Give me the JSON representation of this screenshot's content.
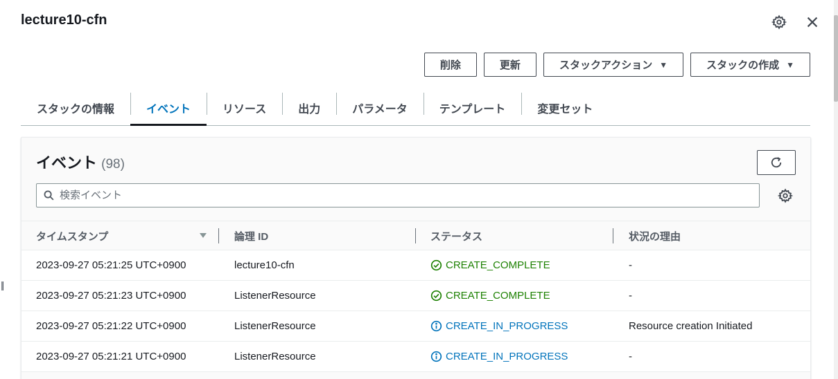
{
  "window": {
    "title": "lecture10-cfn"
  },
  "actions": {
    "delete_label": "削除",
    "update_label": "更新",
    "stack_actions_label": "スタックアクション",
    "create_stack_label": "スタックの作成"
  },
  "tabs": [
    {
      "label": "スタックの情報"
    },
    {
      "label": "イベント"
    },
    {
      "label": "リソース"
    },
    {
      "label": "出力"
    },
    {
      "label": "パラメータ"
    },
    {
      "label": "テンプレート"
    },
    {
      "label": "変更セット"
    }
  ],
  "events": {
    "title": "イベント",
    "count": "(98)",
    "search_placeholder": "検索イベント",
    "columns": {
      "timestamp": "タイムスタンプ",
      "logical_id": "論理 ID",
      "status": "ステータス",
      "reason": "状況の理由"
    },
    "rows": [
      {
        "timestamp": "2023-09-27 05:21:25 UTC+0900",
        "logical_id": "lecture10-cfn",
        "status": "CREATE_COMPLETE",
        "reason": "-"
      },
      {
        "timestamp": "2023-09-27 05:21:23 UTC+0900",
        "logical_id": "ListenerResource",
        "status": "CREATE_COMPLETE",
        "reason": "-"
      },
      {
        "timestamp": "2023-09-27 05:21:22 UTC+0900",
        "logical_id": "ListenerResource",
        "status": "CREATE_IN_PROGRESS",
        "reason": "Resource creation Initiated"
      },
      {
        "timestamp": "2023-09-27 05:21:21 UTC+0900",
        "logical_id": "ListenerResource",
        "status": "CREATE_IN_PROGRESS",
        "reason": "-"
      }
    ]
  },
  "colors": {
    "success": "#1d8102",
    "in_progress": "#0073bb",
    "active_tab": "#0073bb"
  },
  "icons": {
    "settings": "gear-icon",
    "close": "close-icon",
    "refresh": "refresh-icon",
    "search": "search-icon",
    "sort": "sort-desc-icon",
    "complete": "check-circle-icon",
    "progress": "info-circle-icon"
  }
}
